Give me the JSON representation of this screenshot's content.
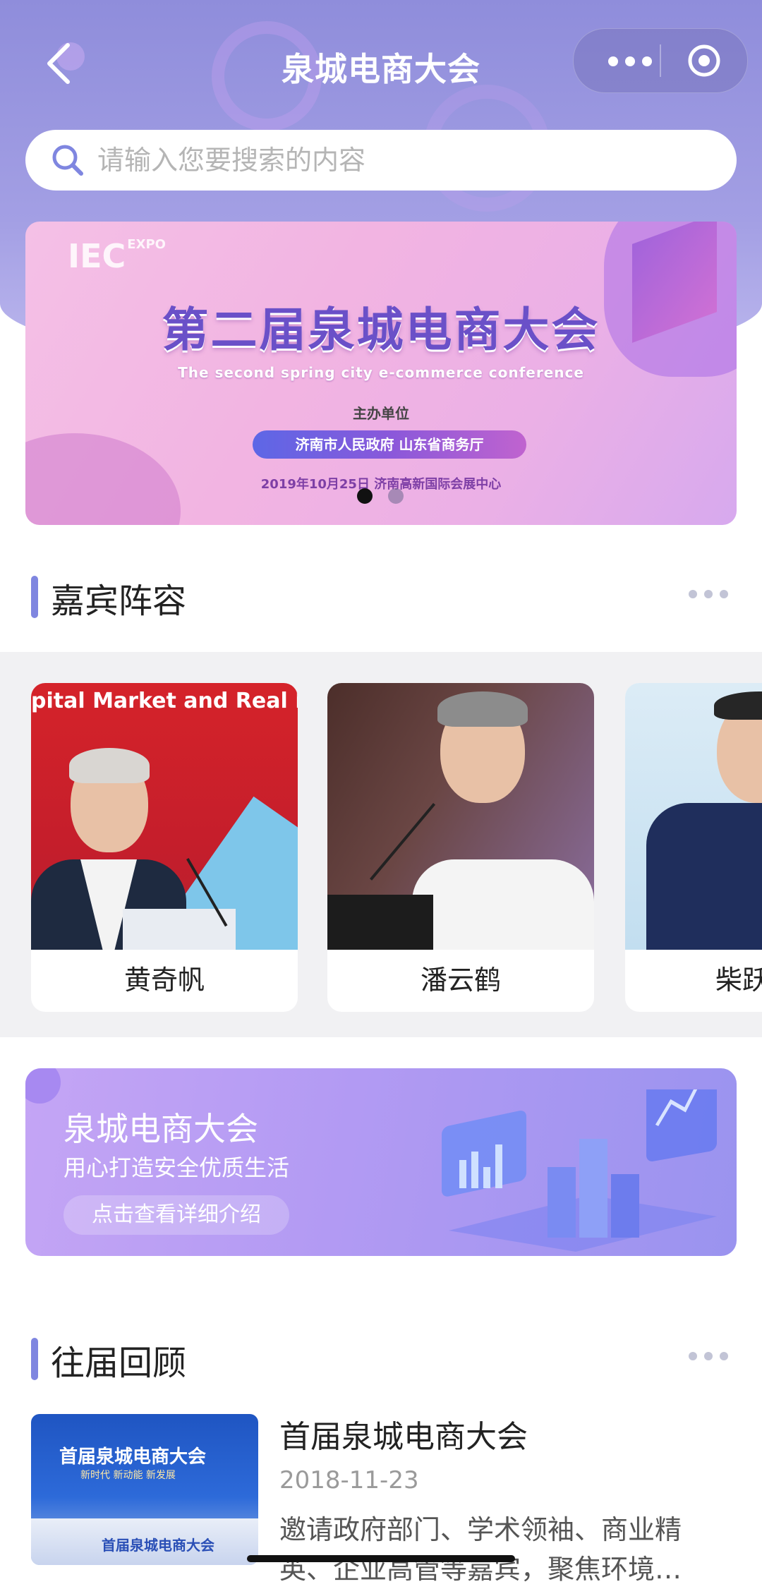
{
  "header": {
    "title": "泉城电商大会",
    "back_label": "",
    "colors": {
      "bg": "#9b97e0",
      "accent": "#7f86e0"
    }
  },
  "search": {
    "placeholder": "请输入您要搜索的内容",
    "value": ""
  },
  "banner": {
    "logo": "IEC",
    "logo_suffix": "EXPO",
    "title": "第二届泉城电商大会",
    "subtitle_en": "The second spring city e-commerce conference",
    "host_label": "主办单位",
    "organizers": "济南市人民政府 山东省商务厅",
    "date_venue": "2019年10月25日  济南高新国际会展中心",
    "slides": 2,
    "active_slide": 1
  },
  "guests_section": {
    "title": "嘉宾阵容",
    "speakers": [
      {
        "name": "黄奇帆",
        "photo_text": "pital Market and Real Ec"
      },
      {
        "name": "潘云鹤"
      },
      {
        "name": "柴跃"
      }
    ]
  },
  "promo": {
    "title": "泉城电商大会",
    "subtitle": "用心打造安全优质生活",
    "button": "点击查看详细介绍"
  },
  "past_section": {
    "title": "往届回顾",
    "items": [
      {
        "title": "首届泉城电商大会",
        "date": "2018-11-23",
        "desc": "邀请政府部门、学术领袖、商业精英、企业高管等嘉宾，聚焦环境…",
        "thumb_title": "首届泉城电商大会",
        "thumb_sub": "新时代 新动能 新发展",
        "thumb_stage": "首届泉城电商大会"
      }
    ]
  }
}
